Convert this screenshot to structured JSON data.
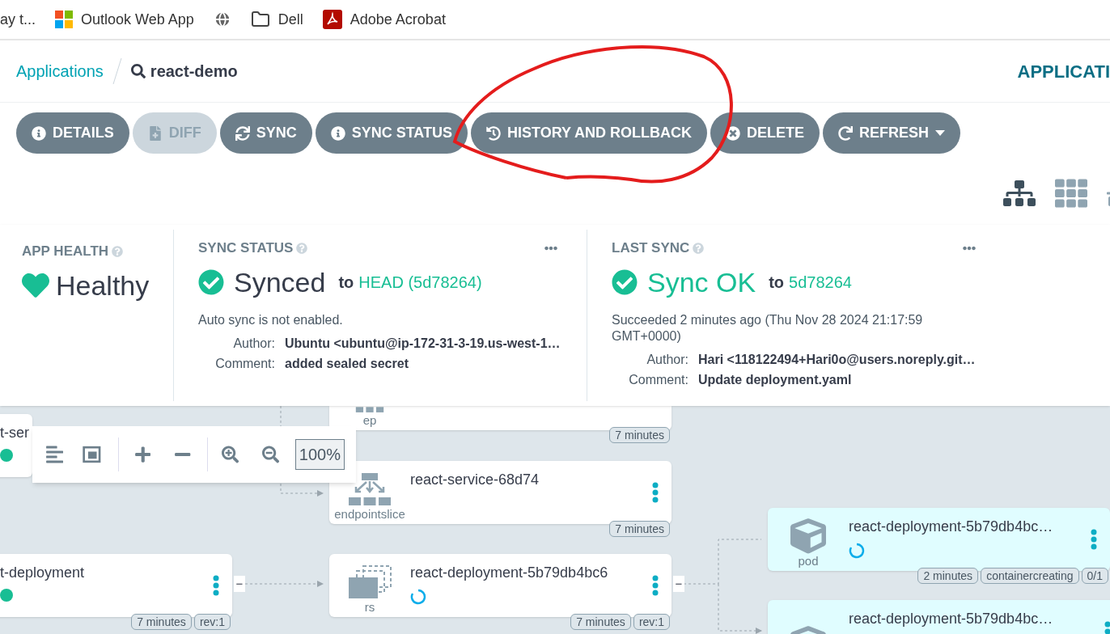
{
  "bookmarks": [
    {
      "label": "ay t...",
      "kind": "none"
    },
    {
      "label": "Outlook Web App",
      "kind": "windows"
    },
    {
      "kind": "globe"
    },
    {
      "label": "Dell",
      "kind": "folder"
    },
    {
      "label": "Adobe Acrobat",
      "kind": "pdf"
    }
  ],
  "breadcrumb": {
    "parent": "Applications",
    "current": "react-demo"
  },
  "top_right_link": "APPLICATI",
  "actions": [
    {
      "label": "DETAILS",
      "disabled": false
    },
    {
      "label": "DIFF",
      "disabled": true
    },
    {
      "label": "SYNC",
      "disabled": false
    },
    {
      "label": "SYNC STATUS",
      "disabled": false
    },
    {
      "label": "HISTORY AND ROLLBACK",
      "disabled": false
    },
    {
      "label": "DELETE",
      "disabled": false
    },
    {
      "label": "REFRESH",
      "disabled": false,
      "dropdown": true
    }
  ],
  "view_modes": [
    {
      "kind": "tree",
      "selected": true
    },
    {
      "kind": "grid",
      "selected": false
    },
    {
      "kind": "network",
      "selected": false
    }
  ],
  "app_health": {
    "title": "APP HEALTH",
    "status": "Healthy"
  },
  "sync_status": {
    "title": "SYNC STATUS",
    "status": "Synced",
    "to": "to",
    "revision": "HEAD (5d78264)",
    "note": "Auto sync is not enabled.",
    "fields": [
      {
        "label": "Author:",
        "value": "Ubuntu <ubuntu@ip-172-31-3-19.us-west-1…"
      },
      {
        "label": "Comment:",
        "value": "added sealed secret"
      }
    ]
  },
  "last_sync": {
    "title": "LAST SYNC",
    "status": "Sync OK",
    "to": "to",
    "revision": "5d78264",
    "note": "Succeeded 2 minutes ago (Thu Nov 28 2024 21:17:59 GMT+0000)",
    "fields": [
      {
        "label": "Author:",
        "value": "Hari <118122494+Hari0o@users.noreply.git…"
      },
      {
        "label": "Comment:",
        "value": "Update deployment.yaml"
      }
    ]
  },
  "zoom_toolbar": {
    "zoom": "100%"
  },
  "nodes": [
    {
      "name": "t-ser",
      "kind": "plain",
      "progressing": false,
      "highlighted": false
    },
    {
      "type_label": "ep",
      "kind": "endpoints",
      "highlighted": false,
      "badges": [
        "7 minutes"
      ]
    },
    {
      "name": "react-service-68d74",
      "type_label": "endpointslice",
      "kind": "endpointslice",
      "highlighted": false,
      "menu": true,
      "badges": [
        "7 minutes"
      ]
    },
    {
      "name": "t-deployment",
      "kind": "plain",
      "progressing": false,
      "highlighted": false,
      "menu": true,
      "collapse": "−",
      "badges": [
        "7 minutes",
        "rev:1"
      ]
    },
    {
      "name": "react-deployment-5b79db4bc6",
      "type_label": "rs",
      "kind": "replicaset",
      "progressing": true,
      "highlighted": false,
      "menu": true,
      "collapse": "−",
      "badges": [
        "7 minutes",
        "rev:1"
      ]
    },
    {
      "name": "react-deployment-5b79db4bc…",
      "type_label": "pod",
      "kind": "pod",
      "progressing": true,
      "highlighted": true,
      "menu": true,
      "badges": [
        "2 minutes",
        "containercreating",
        "0/1"
      ]
    },
    {
      "name": "react-deployment-5b79db4bc…",
      "kind": "pod",
      "highlighted": true,
      "menu": true
    }
  ]
}
